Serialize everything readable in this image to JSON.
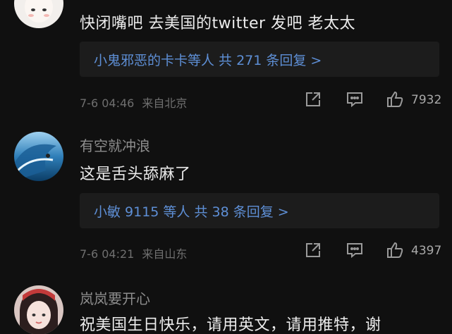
{
  "comments": [
    {
      "username": "",
      "text": "快闭嘴吧 去美国的twitter 发吧 老太太",
      "reply_summary": "小鬼邪恶的卡卡等人  共 271 条回复 >",
      "date": "7-6 04:46",
      "location": "来自北京",
      "likes": "7932"
    },
    {
      "username": "有空就冲浪",
      "text": "这是舌头舔麻了",
      "reply_summary": "小敏 9115 等人  共 38 条回复 >",
      "date": "7-6 04:21",
      "location": "来自山东",
      "likes": "4397"
    },
    {
      "username": "岚岚要开心",
      "text": "祝美国生日快乐，请用英文，请用推特，谢",
      "reply_summary": "",
      "date": "",
      "location": "",
      "likes": ""
    }
  ],
  "icons": {
    "share": "share-icon",
    "comment": "comment-icon",
    "like": "thumbs-up-icon"
  },
  "colors": {
    "background": "#101010",
    "reply_link": "#5e8fd6",
    "meta_text": "#6f6f6f"
  }
}
